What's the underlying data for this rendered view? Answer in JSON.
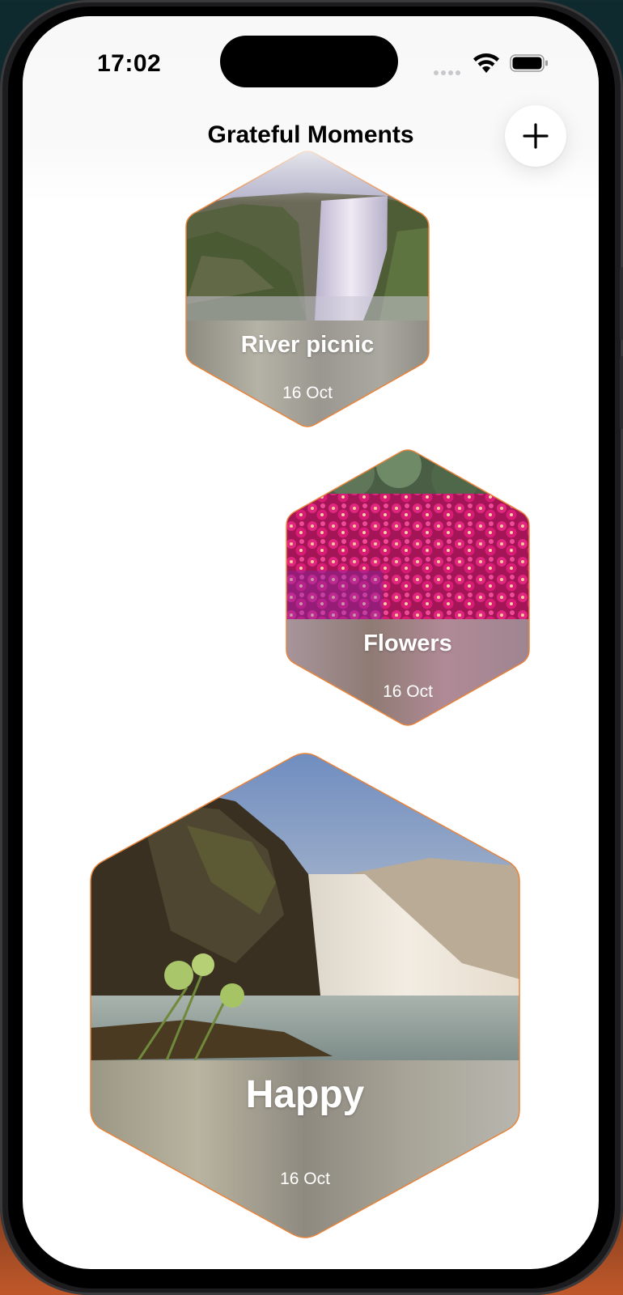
{
  "status_bar": {
    "time": "17:02"
  },
  "header": {
    "title": "Grateful Moments",
    "add_button_symbol": "+"
  },
  "colors": {
    "card_border": "#e8843c",
    "background": "#ffffff"
  },
  "moments": [
    {
      "title": "River picnic",
      "date": "16 Oct",
      "image": "waterfall-cliff"
    },
    {
      "title": "Flowers",
      "date": "16 Oct",
      "image": "magenta-flowers"
    },
    {
      "title": "Happy",
      "date": "16 Oct",
      "image": "waterfall-river"
    }
  ]
}
